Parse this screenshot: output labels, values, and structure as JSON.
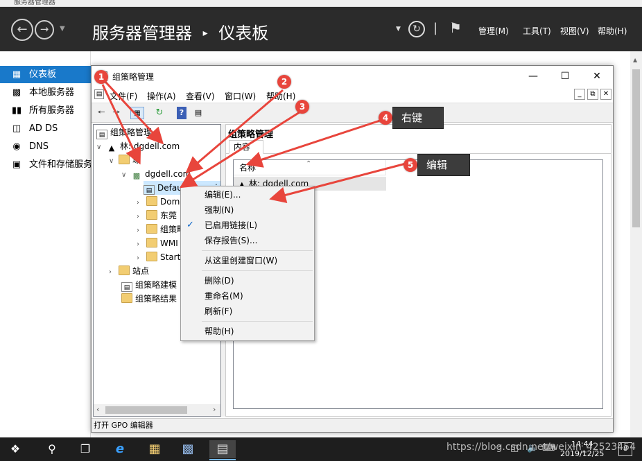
{
  "server_manager": {
    "window_title": "服务器管理器",
    "breadcrumb": [
      "服务器管理器",
      "仪表板"
    ],
    "menus": [
      "管理(M)",
      "工具(T)",
      "视图(V)",
      "帮助(H)"
    ],
    "sidebar": [
      {
        "label": "仪表板",
        "icon": "dashboard-icon",
        "selected": true
      },
      {
        "label": "本地服务器",
        "icon": "server-icon"
      },
      {
        "label": "所有服务器",
        "icon": "servers-icon"
      },
      {
        "label": "AD DS",
        "icon": "adds-icon"
      },
      {
        "label": "DNS",
        "icon": "dns-icon"
      },
      {
        "label": "文件和存储服务",
        "icon": "storage-icon"
      }
    ]
  },
  "gpmc": {
    "title": "组策略管理",
    "menus": [
      "文件(F)",
      "操作(A)",
      "查看(V)",
      "窗口(W)",
      "帮助(H)"
    ],
    "tree": {
      "root": "组策略管理",
      "forest": "林: dgdell.com",
      "domains": "域",
      "domain": "dgdell.com",
      "children": [
        "Default Domain Policy",
        "Domain Controllers",
        "东莞",
        "组策略对象",
        "WMI 筛选器",
        "Starter GPO"
      ],
      "sites": "站点",
      "modeling": "组策略建模",
      "results": "组策略结果"
    },
    "right_header": "组策略管理",
    "tab": "内容",
    "column_name": "名称",
    "row": "林: dgdell.com",
    "status": "打开 GPO 编辑器"
  },
  "context_menu": {
    "items": [
      "编辑(E)...",
      "强制(N)",
      "已启用链接(L)",
      "保存报告(S)...",
      "从这里创建窗口(W)",
      "删除(D)",
      "重命名(M)",
      "刷新(F)",
      "帮助(H)"
    ]
  },
  "annotations": {
    "badges": [
      "1",
      "2",
      "3",
      "4",
      "5"
    ],
    "notes": [
      "右键",
      "编辑"
    ]
  },
  "taskbar": {
    "time": "14:44",
    "date": "2019/12/25",
    "notification_count": "8",
    "watermark": "https://blog.csdn.net/weixin_42523454"
  },
  "colors": {
    "header_bg": "#2b2b2b",
    "selected_blue": "#1979ca",
    "badge_red": "#e8453c",
    "note_bg": "#3c3c3c",
    "arrow_red": "#e8453c"
  }
}
